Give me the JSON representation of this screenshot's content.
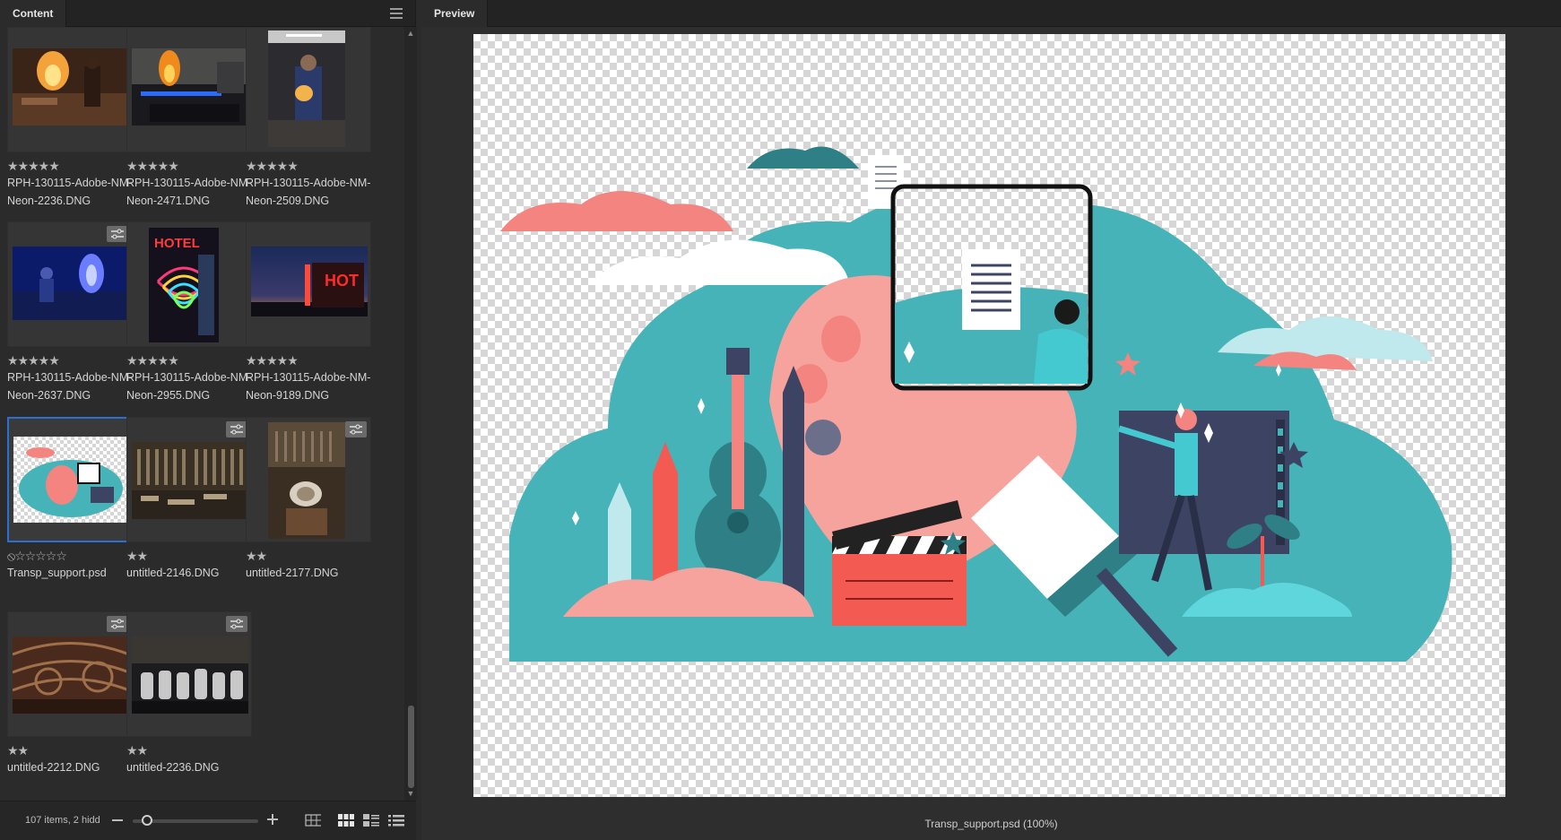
{
  "content_panel": {
    "tab_label": "Content",
    "items": [
      {
        "stars": "★★★★★",
        "name": "RPH-130115-Adobe-NM-\nNeon-2236.DNG"
      },
      {
        "stars": "★★★★★",
        "name": "RPH-130115-Adobe-NM-\nNeon-2471.DNG"
      },
      {
        "stars": "★★★★★",
        "name": "RPH-130115-Adobe-NM-\nNeon-2509.DNG"
      },
      {
        "stars": "★★★★★",
        "name": "RPH-130115-Adobe-NM-\nNeon-2637.DNG"
      },
      {
        "stars": "★★★★★",
        "name": "RPH-130115-Adobe-NM-\nNeon-2955.DNG"
      },
      {
        "stars": "★★★★★",
        "name": "RPH-130115-Adobe-NM-\nNeon-9189.DNG"
      },
      {
        "stars": "⦸☆☆☆☆☆",
        "name": "Transp_support.psd"
      },
      {
        "stars": "★★",
        "name": "untitled-2146.DNG"
      },
      {
        "stars": "★★",
        "name": "untitled-2177.DNG"
      },
      {
        "stars": "★★",
        "name": "untitled-2212.DNG"
      },
      {
        "stars": "★★",
        "name": "untitled-2236.DNG"
      }
    ],
    "status": {
      "count_text": "107 items, 2 hidd"
    }
  },
  "preview_panel": {
    "tab_label": "Preview",
    "caption": "Transp_support.psd (100%)",
    "hot_sign": "HOT",
    "hotel_sign": "HOTEL"
  },
  "colors": {
    "panel_bg": "#2b2b2b",
    "selection": "#2d6fd1",
    "teal": "#45b3b8",
    "coral": "#f4847f",
    "navy": "#3d4463"
  },
  "icons": {
    "panel_menu": "hamburger-menu-icon",
    "settings_badge": "develop-settings-icon",
    "view_grid": "grid-view-icon",
    "view_thumbs": "thumbnail-view-icon",
    "view_details": "details-view-icon",
    "view_list": "list-view-icon"
  }
}
